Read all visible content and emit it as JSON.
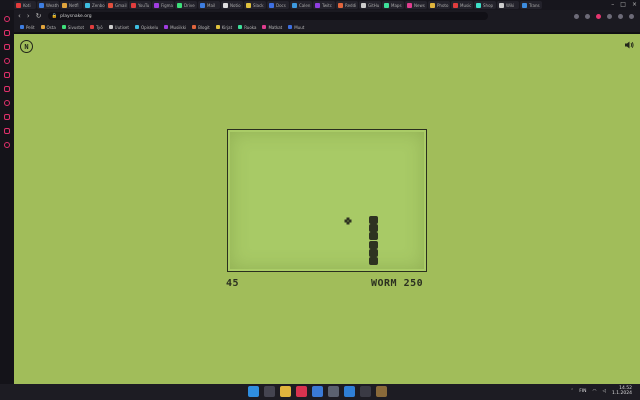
{
  "browser": {
    "tabs": [
      {
        "label": "Koti",
        "color": "#e33b3b"
      },
      {
        "label": "Weath",
        "color": "#3d7de0"
      },
      {
        "label": "Netfl",
        "color": "#e0a43d"
      },
      {
        "label": "Zenbo",
        "color": "#3dbde0"
      },
      {
        "label": "Gmail",
        "color": "#e04f3d"
      },
      {
        "label": "YouTu",
        "color": "#e03d3d"
      },
      {
        "label": "Figma",
        "color": "#a03de0"
      },
      {
        "label": "Drive",
        "color": "#3de07a"
      },
      {
        "label": "Mail",
        "color": "#3d7de0"
      },
      {
        "label": "Notio",
        "color": "#dddddd"
      },
      {
        "label": "Slack",
        "color": "#e0c23d"
      },
      {
        "label": "Docs",
        "color": "#3d6fe0"
      },
      {
        "label": "Calen",
        "color": "#3d9ae0"
      },
      {
        "label": "Twitc",
        "color": "#8f3de0"
      },
      {
        "label": "Reddi",
        "color": "#e0653d"
      },
      {
        "label": "GitHu",
        "color": "#cccccc"
      },
      {
        "label": "Maps",
        "color": "#3de09a"
      },
      {
        "label": "News",
        "color": "#e03d8f"
      },
      {
        "label": "Photo",
        "color": "#e0b53d"
      },
      {
        "label": "Music",
        "color": "#e03d3d"
      },
      {
        "label": "Shop",
        "color": "#3de0c8"
      },
      {
        "label": "Wiki",
        "color": "#cccccc"
      },
      {
        "label": "Trans",
        "color": "#3d8de0"
      }
    ],
    "url": "playsnake.org"
  },
  "bookmarks": [
    {
      "label": "Pelit",
      "color": "#3d7de0"
    },
    {
      "label": "Osta",
      "color": "#e0a43d"
    },
    {
      "label": "Sivustot",
      "color": "#3de07a"
    },
    {
      "label": "Työ",
      "color": "#e03d3d"
    },
    {
      "label": "Uutiset",
      "color": "#cccccc"
    },
    {
      "label": "Opiskelu",
      "color": "#3dbde0"
    },
    {
      "label": "Musiikki",
      "color": "#a03de0"
    },
    {
      "label": "Blogit",
      "color": "#e0653d"
    },
    {
      "label": "Kirjat",
      "color": "#e0c23d"
    },
    {
      "label": "Ruoka",
      "color": "#3de09a"
    },
    {
      "label": "Matkat",
      "color": "#e03d8f"
    },
    {
      "label": "Muut",
      "color": "#3d6fe0"
    }
  ],
  "game": {
    "logo": "N",
    "score": "45",
    "status": "WORM 250",
    "colors": {
      "background": "#a1bd5a",
      "board": "#aacc67",
      "snake": "#2e3321",
      "ink": "#2b3020"
    },
    "snake_cells": [
      [
        0,
        0
      ],
      [
        0,
        1
      ],
      [
        0,
        2
      ],
      [
        0,
        3
      ],
      [
        0,
        4
      ],
      [
        0,
        5
      ]
    ],
    "food_icon": "food-icon"
  },
  "taskbar": {
    "apps": [
      {
        "name": "start",
        "color": "#2f8ee0"
      },
      {
        "name": "search",
        "color": "#444450"
      },
      {
        "name": "files",
        "color": "#e0b43d"
      },
      {
        "name": "opera",
        "color": "#d8334f"
      },
      {
        "name": "store",
        "color": "#3a7ad6"
      },
      {
        "name": "settings",
        "color": "#5b6170"
      },
      {
        "name": "vscode",
        "color": "#2f7fd6"
      },
      {
        "name": "terminal",
        "color": "#3a3a44"
      },
      {
        "name": "other",
        "color": "#8a6a3a"
      }
    ],
    "tray_lang": "FIN",
    "time": "14.52",
    "date": "1.1.2024"
  }
}
